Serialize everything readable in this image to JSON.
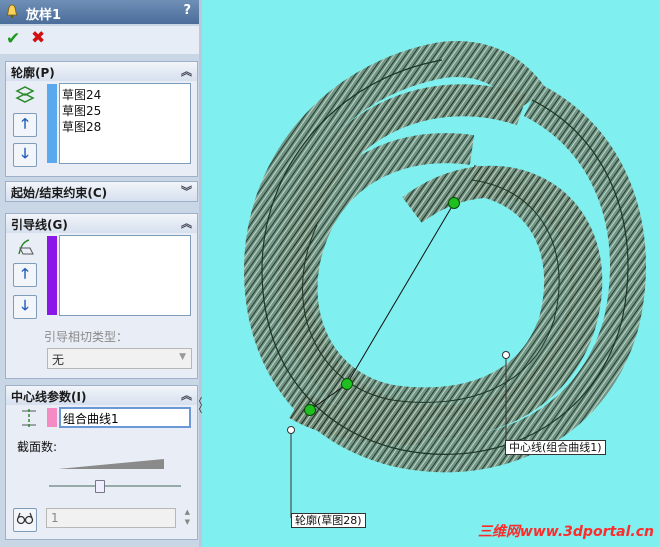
{
  "window": {
    "title": "放样1",
    "help": "?"
  },
  "actions": {
    "ok_icon": "checkmark-icon",
    "cancel_icon": "cross-icon"
  },
  "sections": {
    "profile": {
      "title": "轮廓(P)",
      "items": [
        "草图24",
        "草图25",
        "草图28"
      ],
      "bar_color": "#5aa9ee"
    },
    "constraints": {
      "title": "起始/结束约束(C)"
    },
    "guides": {
      "title": "引导线(G)",
      "bar_color": "#8a16e8",
      "tangency_label": "引导相切类型：",
      "tangency_value": "无"
    },
    "centerline": {
      "title": "中心线参数(I)",
      "bar_color": "#f48bc4",
      "value": "组合曲线1",
      "sections_label": "截面数:",
      "sections_value": "1",
      "slider_fraction": 0.38
    }
  },
  "viewport": {
    "background": "#7ff0ef",
    "callouts": {
      "centerline": "中心线(组合曲线1)",
      "profile": "轮廓(草图28)"
    },
    "watermark": "三维网www.3dportal.cn"
  }
}
